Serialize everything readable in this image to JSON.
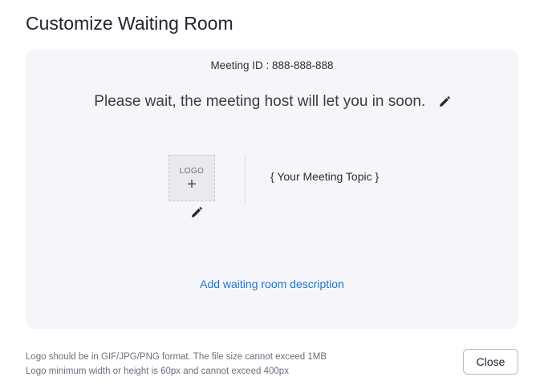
{
  "dialog": {
    "title": "Customize Waiting Room"
  },
  "preview": {
    "meeting_id": "Meeting ID : 888-888-888",
    "wait_message": "Please wait, the meeting host will let you in soon.",
    "logo_label": "LOGO",
    "logo_add_symbol": "+",
    "meeting_topic": "{ Your Meeting Topic }",
    "add_description_link": "Add waiting room description"
  },
  "footer": {
    "hints": [
      "Logo should be in GIF/JPG/PNG format. The file size cannot exceed 1MB",
      "Logo minimum width or height is 60px and cannot exceed 400px"
    ],
    "close_label": "Close"
  },
  "icons": {
    "edit": "pencil-icon",
    "logo_add": "plus-icon"
  },
  "colors": {
    "panel_background": "#f6f6fa",
    "link": "#1a73d9",
    "text_primary": "#232333",
    "text_muted": "#6e6e7e"
  }
}
